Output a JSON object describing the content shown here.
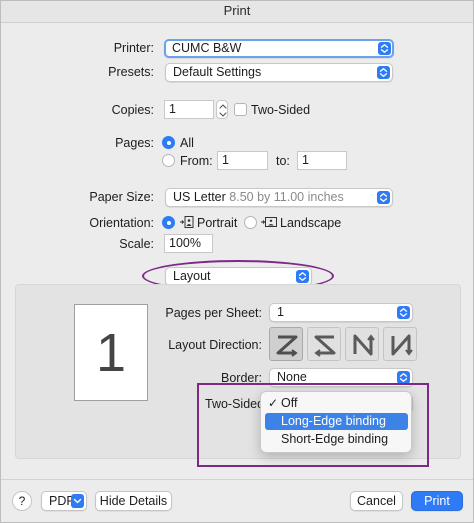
{
  "window": {
    "title": "Print"
  },
  "printer": {
    "label": "Printer:",
    "value": "CUMC B&W"
  },
  "presets": {
    "label": "Presets:",
    "value": "Default Settings"
  },
  "copies": {
    "label": "Copies:",
    "value": "1",
    "two_sided_label": "Two-Sided",
    "two_sided_checked": false
  },
  "pages": {
    "label": "Pages:",
    "all_label": "All",
    "from_label": "From:",
    "from_value": "1",
    "to_label": "to:",
    "to_value": "1",
    "selected": "All"
  },
  "paper_size": {
    "label": "Paper Size:",
    "value": "US Letter",
    "detail": "8.50 by 11.00 inches"
  },
  "orientation": {
    "label": "Orientation:",
    "portrait_label": "Portrait",
    "landscape_label": "Landscape",
    "selected": "Portrait"
  },
  "scale": {
    "label": "Scale:",
    "value": "100%"
  },
  "section_select": {
    "value": "Layout"
  },
  "layout": {
    "preview_page": "1",
    "pages_per_sheet_label": "Pages per Sheet:",
    "pages_per_sheet_value": "1",
    "direction_label": "Layout Direction:",
    "border_label": "Border:",
    "border_value": "None",
    "two_sided_label": "Two-Sided:"
  },
  "two_sided_menu": {
    "items": [
      {
        "label": "Off",
        "checked": true,
        "highlighted": false
      },
      {
        "label": "Long-Edge binding",
        "checked": false,
        "highlighted": true
      },
      {
        "label": "Short-Edge binding",
        "checked": false,
        "highlighted": false
      }
    ]
  },
  "footer": {
    "help": "?",
    "pdf_label": "PDF",
    "hide_details": "Hide Details",
    "cancel": "Cancel",
    "print": "Print"
  },
  "colors": {
    "accent": "#2f7bf6",
    "menu_highlight": "#3d82e6",
    "annotation": "#7b2a86"
  }
}
